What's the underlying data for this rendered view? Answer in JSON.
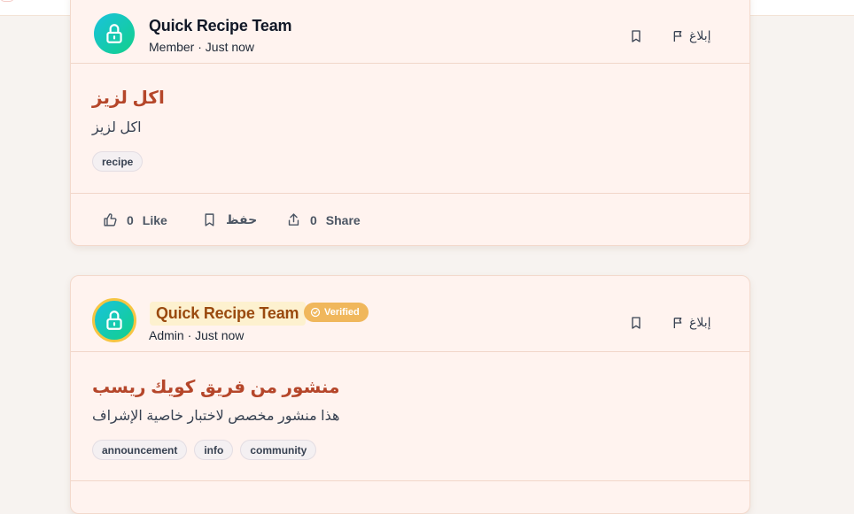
{
  "posts": [
    {
      "author": "Quick Recipe Team",
      "meta": "Member · Just now",
      "title": "اكل لزيز",
      "body": "اكل لزيز",
      "tags": [
        "recipe"
      ],
      "report_label": "إبلاغ",
      "likes": "0",
      "like_label": "Like",
      "save_label": "حفظ",
      "shares": "0",
      "share_label": "Share"
    },
    {
      "author": "Quick Recipe Team",
      "badge": "Verified",
      "meta": "Admin · Just now",
      "title": "منشور من فريق كويك ريسب",
      "body": "هذا منشور مخصص لاختبار خاصية الإشراف",
      "tags": [
        "announcement",
        "info",
        "community"
      ],
      "report_label": "إبلاغ"
    }
  ],
  "colors": {
    "title": "#b5462a",
    "verified_badge": "#f0b75c",
    "avatar_gradient_start": "#19c2dd",
    "avatar_gradient_end": "#12d08a"
  }
}
